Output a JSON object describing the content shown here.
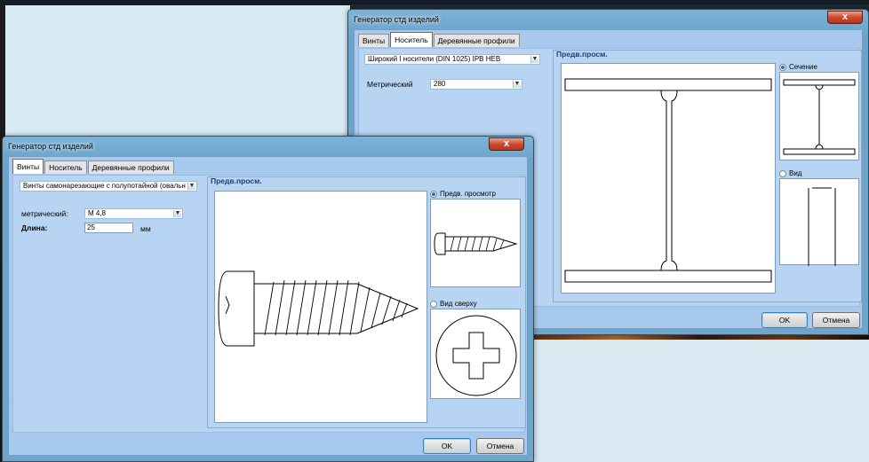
{
  "background_window": {
    "title": "Генератор стд изделий",
    "close_label": "x",
    "tabs": [
      {
        "label": "Винты"
      },
      {
        "label": "Носитель"
      },
      {
        "label": "Деревянные профили"
      }
    ],
    "active_tab": "Носитель",
    "profile_combo": {
      "value": "Широкий I носители (DIN 1025) IPB   HEB"
    },
    "metric_label": "Метрический",
    "metric_combo": {
      "value": "280"
    },
    "preview_title": "Предв.просм.",
    "options": [
      {
        "label": "Сечение",
        "selected": true
      },
      {
        "label": "Вид",
        "selected": false
      }
    ],
    "ok_label": "OK",
    "cancel_label": "Отмена"
  },
  "front_window": {
    "title": "Генератор стд изделий",
    "close_label": "x",
    "tabs": [
      {
        "label": "Винты"
      },
      {
        "label": "Носитель"
      },
      {
        "label": "Деревянные профили"
      }
    ],
    "active_tab": "Винты",
    "type_combo": {
      "value": "Винты самонарезающие с полупотайной (овальн"
    },
    "metric_label": "метрический:",
    "metric_combo": {
      "value": "M 4,8"
    },
    "length_label": "Длина:",
    "length_value": "25",
    "length_unit": "мм",
    "preview_title": "Предв.просм.",
    "options": [
      {
        "label": "Предв. просмотр",
        "selected": true
      },
      {
        "label": "Вид сверху",
        "selected": false
      }
    ],
    "ok_label": "OK",
    "cancel_label": "Отмена"
  },
  "colors": {
    "dialog_bg": "#a6c9ed",
    "title_accent": "#1f3d79",
    "close_button": "#d04930"
  },
  "icons": [
    "dropdown-arrow-icon",
    "close-icon",
    "radio-icon"
  ]
}
